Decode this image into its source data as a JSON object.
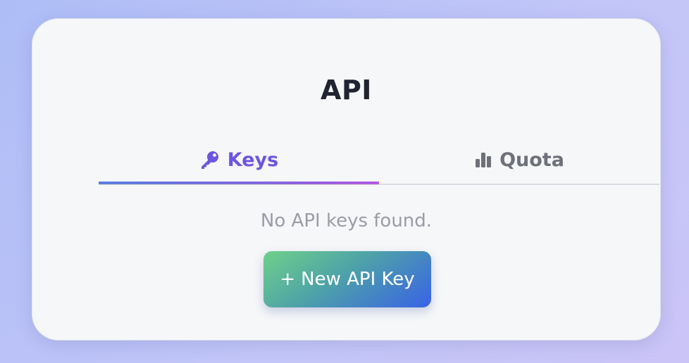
{
  "card": {
    "title": "API"
  },
  "tabs": [
    {
      "label": "Keys",
      "icon": "key-icon",
      "active": true
    },
    {
      "label": "Quota",
      "icon": "bar-chart-icon",
      "active": false
    }
  ],
  "keys_panel": {
    "empty_message": "No API keys found.",
    "new_button_icon": "+",
    "new_button_label": "New API Key"
  },
  "colors": {
    "active_tab": "#6c55e0",
    "inactive_tab": "#6e707a",
    "title": "#1f2430",
    "empty_text": "#9a9ca6",
    "button_gradient_start": "#6fd08a",
    "button_gradient_end": "#3962e6"
  }
}
